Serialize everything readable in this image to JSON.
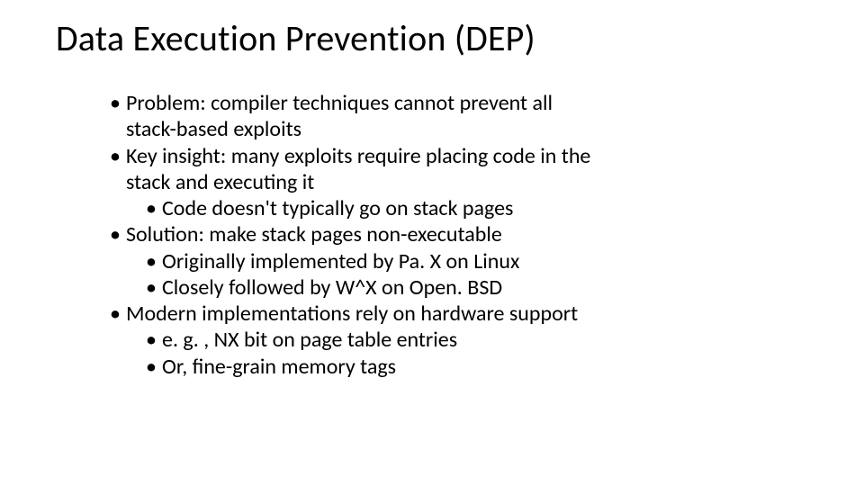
{
  "slide": {
    "title": "Data Execution Prevention (DEP)",
    "bullets": {
      "b1_line1": "Problem: compiler techniques cannot prevent all",
      "b1_line2": "stack-based exploits",
      "b2_line1": "Key insight: many exploits require placing code in the",
      "b2_line2": "stack and executing it",
      "b2_sub1": "Code doesn't typically go on stack pages",
      "b3": "Solution: make stack pages non-executable",
      "b3_sub1": "Originally implemented by Pa. X on Linux",
      "b3_sub2": "Closely followed by W^X on Open. BSD",
      "b4": "Modern implementations rely on hardware support",
      "b4_sub1": "e. g. , NX bit on page table entries",
      "b4_sub2": "Or, fine-grain memory tags"
    }
  }
}
